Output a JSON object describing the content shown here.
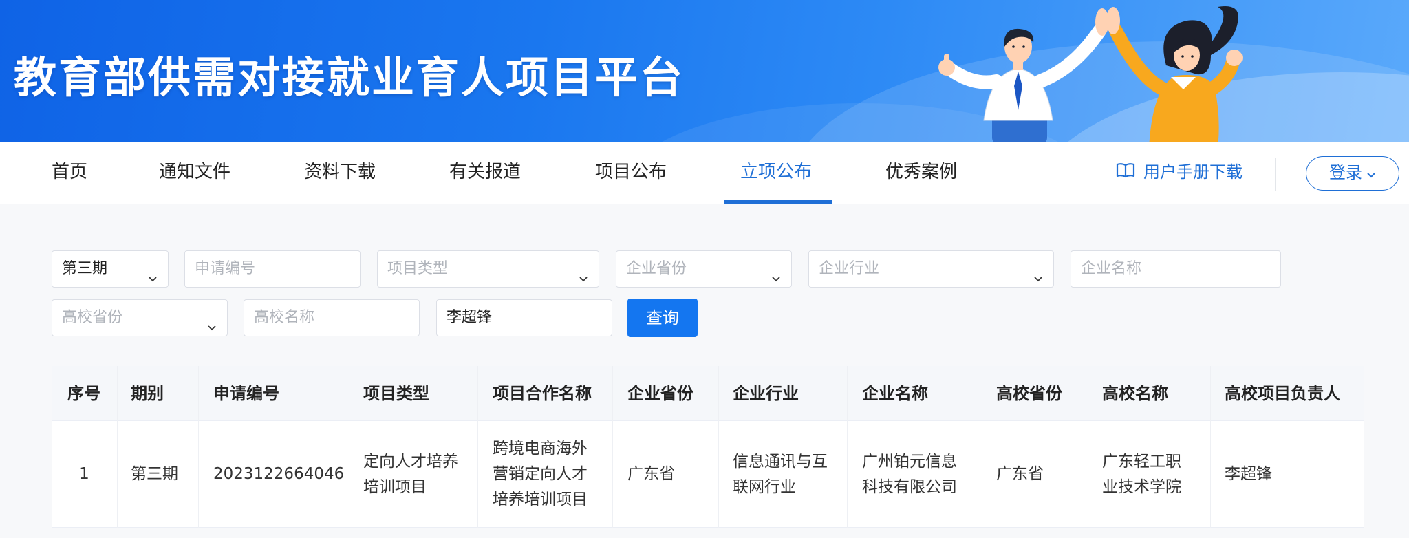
{
  "banner": {
    "title": "教育部供需对接就业育人项目平台"
  },
  "nav": {
    "items": [
      "首页",
      "通知文件",
      "资料下载",
      "有关报道",
      "项目公布",
      "立项公布",
      "优秀案例"
    ],
    "active_index": 5,
    "manual_label": "用户手册下载",
    "login_label": "登录"
  },
  "filters": {
    "period": "第三期",
    "app_no_placeholder": "申请编号",
    "project_type_placeholder": "项目类型",
    "company_province_placeholder": "企业省份",
    "company_industry_placeholder": "企业行业",
    "company_name_placeholder": "企业名称",
    "school_province_placeholder": "高校省份",
    "school_name_placeholder": "高校名称",
    "leader_value": "李超锋",
    "query_label": "查询"
  },
  "table": {
    "headers": [
      "序号",
      "期别",
      "申请编号",
      "项目类型",
      "项目合作名称",
      "企业省份",
      "企业行业",
      "企业名称",
      "高校省份",
      "高校名称",
      "高校项目负责人"
    ],
    "rows": [
      [
        "1",
        "第三期",
        "2023122664046",
        "定向人才培养培训项目",
        "跨境电商海外营销定向人才培养培训项目",
        "广东省",
        "信息通讯与互联网行业",
        "广州铂元信息科技有限公司",
        "广东省",
        "广东轻工职业技术学院",
        "李超锋"
      ]
    ]
  },
  "colors": {
    "brand_blue": "#1f6fd6",
    "button_blue": "#1476f0",
    "banner_blue": "#0f63e6"
  }
}
